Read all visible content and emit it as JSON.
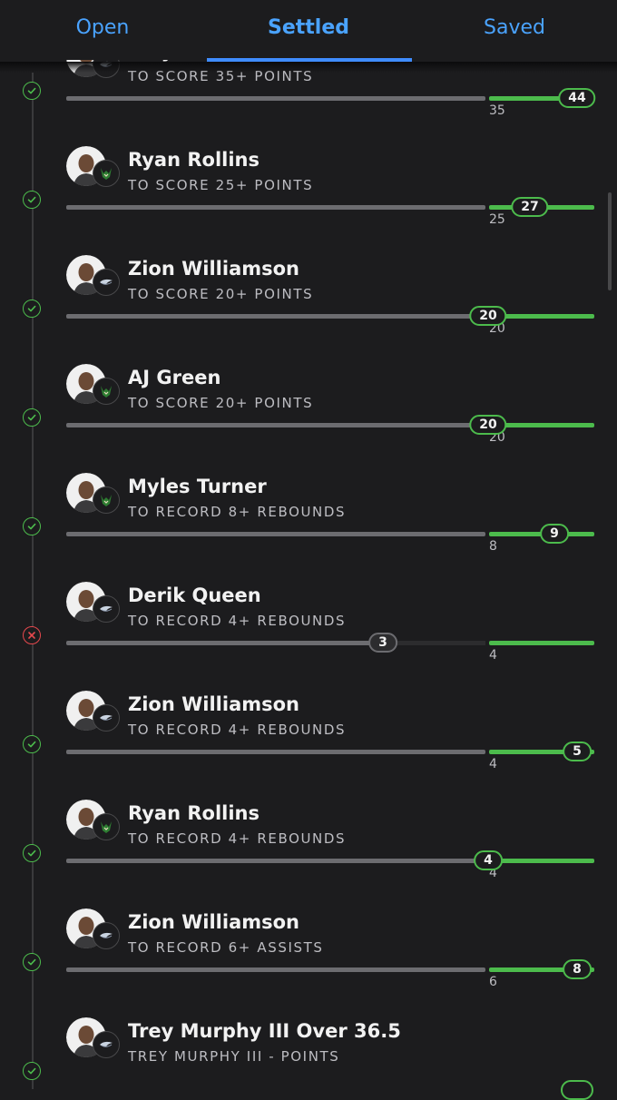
{
  "tabs": [
    {
      "label": "Open"
    },
    {
      "label": "Settled"
    },
    {
      "label": "Saved"
    }
  ],
  "colors": {
    "accent": "#4aa3ff",
    "won": "#4cbb4c",
    "lost": "#e5484d",
    "background": "#1c1c1e"
  },
  "bets": [
    {
      "player": "Trey Murphy III",
      "prop": "TO SCORE 35+ POINTS",
      "threshold": "35",
      "result": "44",
      "status": "won",
      "team": "pelicans-logo"
    },
    {
      "player": "Ryan Rollins",
      "prop": "TO SCORE 25+ POINTS",
      "threshold": "25",
      "result": "27",
      "status": "won",
      "team": "bucks-logo"
    },
    {
      "player": "Zion Williamson",
      "prop": "TO SCORE 20+ POINTS",
      "threshold": "20",
      "result": "20",
      "status": "won",
      "team": "pelicans-logo"
    },
    {
      "player": "AJ Green",
      "prop": "TO SCORE 20+ POINTS",
      "threshold": "20",
      "result": "20",
      "status": "won",
      "team": "bucks-logo"
    },
    {
      "player": "Myles Turner",
      "prop": "TO RECORD 8+ REBOUNDS",
      "threshold": "8",
      "result": "9",
      "status": "won",
      "team": "bucks-logo"
    },
    {
      "player": "Derik Queen",
      "prop": "TO RECORD 4+ REBOUNDS",
      "threshold": "4",
      "result": "3",
      "status": "lost",
      "team": "pelicans-logo"
    },
    {
      "player": "Zion Williamson",
      "prop": "TO RECORD 4+ REBOUNDS",
      "threshold": "4",
      "result": "5",
      "status": "won",
      "team": "pelicans-logo"
    },
    {
      "player": "Ryan Rollins",
      "prop": "TO RECORD 4+ REBOUNDS",
      "threshold": "4",
      "result": "4",
      "status": "won",
      "team": "bucks-logo"
    },
    {
      "player": "Zion Williamson",
      "prop": "TO RECORD 6+ ASSISTS",
      "threshold": "6",
      "result": "8",
      "status": "won",
      "team": "pelicans-logo"
    },
    {
      "player": "Trey Murphy III Over 36.5",
      "prop": "TREY MURPHY III - POINTS",
      "threshold": "",
      "result": "",
      "status": "won",
      "team": "pelicans-logo"
    }
  ]
}
